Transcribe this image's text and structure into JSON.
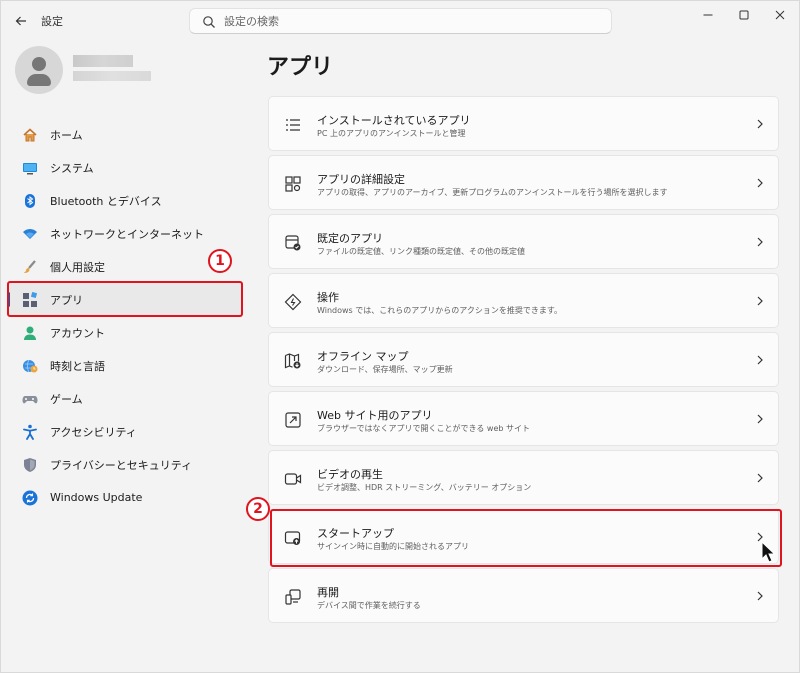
{
  "window": {
    "title": "設定",
    "back_icon": "arrow-left-icon",
    "controls": [
      "minimize-icon",
      "maximize-icon",
      "close-icon"
    ]
  },
  "search": {
    "placeholder": "設定の検索",
    "icon": "search-icon"
  },
  "profile": {
    "avatar_icon": "person-icon"
  },
  "sidebar": {
    "items": [
      {
        "label": "ホーム",
        "icon": "home-icon",
        "active": false
      },
      {
        "label": "システム",
        "icon": "monitor-icon",
        "active": false
      },
      {
        "label": "Bluetooth とデバイス",
        "icon": "bluetooth-icon",
        "active": false
      },
      {
        "label": "ネットワークとインターネット",
        "icon": "wifi-icon",
        "active": false
      },
      {
        "label": "個人用設定",
        "icon": "brush-icon",
        "active": false
      },
      {
        "label": "アプリ",
        "icon": "apps-icon",
        "active": true
      },
      {
        "label": "アカウント",
        "icon": "account-icon",
        "active": false
      },
      {
        "label": "時刻と言語",
        "icon": "globe-clock-icon",
        "active": false
      },
      {
        "label": "ゲーム",
        "icon": "gamepad-icon",
        "active": false
      },
      {
        "label": "アクセシビリティ",
        "icon": "accessibility-icon",
        "active": false
      },
      {
        "label": "プライバシーとセキュリティ",
        "icon": "shield-icon",
        "active": false
      },
      {
        "label": "Windows Update",
        "icon": "update-icon",
        "active": false
      }
    ]
  },
  "main": {
    "title": "アプリ",
    "cards": [
      {
        "title": "インストールされているアプリ",
        "subtitle": "PC 上のアプリのアンインストールと管理",
        "icon": "list-icon"
      },
      {
        "title": "アプリの詳細設定",
        "subtitle": "アプリの取得、アプリのアーカイブ、更新プログラムのアンインストールを行う場所を選択します",
        "icon": "app-settings-icon"
      },
      {
        "title": "既定のアプリ",
        "subtitle": "ファイルの既定値、リンク種類の既定値、その他の既定値",
        "icon": "default-apps-icon"
      },
      {
        "title": "操作",
        "subtitle": "Windows では、これらのアプリからのアクションを推奨できます。",
        "icon": "actions-icon"
      },
      {
        "title": "オフライン マップ",
        "subtitle": "ダウンロード、保存場所、マップ更新",
        "icon": "map-icon"
      },
      {
        "title": "Web サイト用のアプリ",
        "subtitle": "ブラウザーではなくアプリで開くことができる web サイト",
        "icon": "open-link-icon"
      },
      {
        "title": "ビデオの再生",
        "subtitle": "ビデオ調整、HDR ストリーミング、バッテリー オプション",
        "icon": "video-icon"
      },
      {
        "title": "スタートアップ",
        "subtitle": "サインイン時に自動的に開始されるアプリ",
        "icon": "startup-icon"
      },
      {
        "title": "再開",
        "subtitle": "デバイス間で作業を続行する",
        "icon": "resume-icon"
      }
    ]
  },
  "annotations": {
    "step1": "1",
    "step2": "2",
    "color": "#e0141e"
  }
}
